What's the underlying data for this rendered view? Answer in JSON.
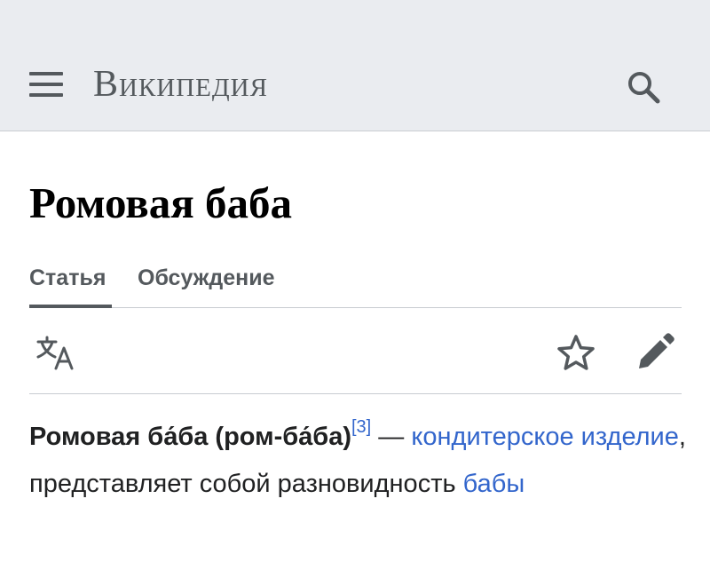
{
  "header": {
    "wordmark": "Википедия",
    "menu_icon": "hamburger-menu-icon",
    "search_icon": "search-icon"
  },
  "page": {
    "title": "Ромовая баба"
  },
  "tabs": [
    {
      "label": "Статья",
      "active": true
    },
    {
      "label": "Обсуждение",
      "active": false
    }
  ],
  "toolbar": {
    "language_icon": "language-icon",
    "watch_icon": "star-icon",
    "edit_icon": "pencil-icon"
  },
  "article": {
    "bold_term": "Ромовая ба́ба (ром-ба́ба)",
    "ref": "[3]",
    "dash": " — ",
    "link1": "кондитерское изделие",
    "text1": ", представляет собой разновидность ",
    "link2": "бабы"
  },
  "colors": {
    "header_bg": "#eaecf0",
    "link": "#3366cc",
    "icon": "#54595d",
    "text": "#202122"
  }
}
